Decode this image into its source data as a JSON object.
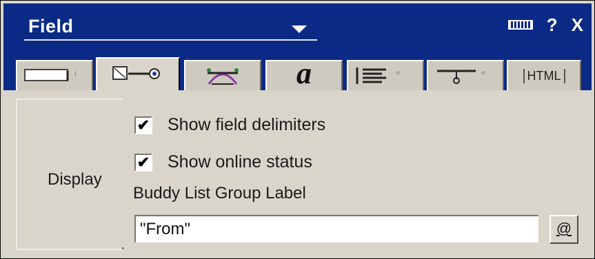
{
  "window": {
    "title": "Field",
    "help_symbol": "?",
    "close_symbol": "X"
  },
  "tabs": [
    {
      "name": "general-tab",
      "icon": "textbox-icon"
    },
    {
      "name": "field-options-tab",
      "icon": "field-key-icon"
    },
    {
      "name": "control-tab",
      "icon": "control-icon"
    },
    {
      "name": "font-tab",
      "label": "a"
    },
    {
      "name": "paragraph-tab",
      "icon": "paragraph-align-icon"
    },
    {
      "name": "hide-when-tab",
      "icon": "hide-when-icon"
    },
    {
      "name": "html-tab",
      "label": "HTML"
    }
  ],
  "display": {
    "section_label": "Display",
    "show_field_delimiters": {
      "label": "Show field delimiters",
      "checked": true,
      "mark": "✔"
    },
    "show_online_status": {
      "label": "Show online status",
      "checked": true,
      "mark": "✔"
    },
    "buddy_list_group_label": {
      "label": "Buddy List Group Label",
      "value": "\"From\""
    },
    "at_button_label": "@"
  },
  "colors": {
    "title_bar": "#0b2a86",
    "panel_bg": "#d9d5cb"
  }
}
